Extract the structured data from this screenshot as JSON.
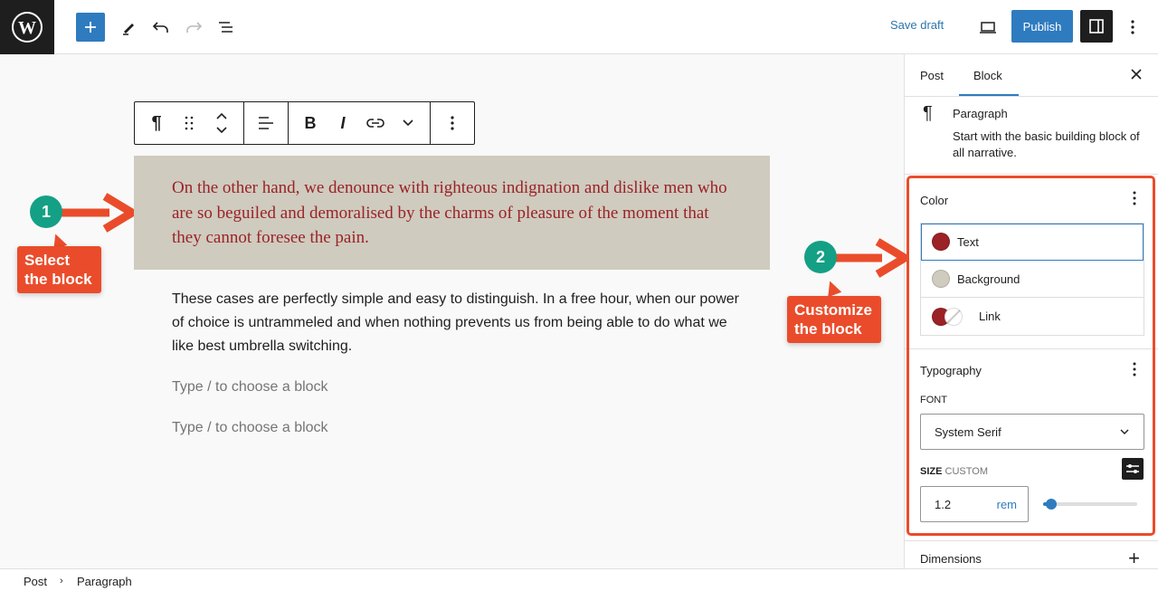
{
  "topbar": {
    "logo": "wordpress-logo",
    "inserter_label": "+",
    "save_draft": "Save draft",
    "publish": "Publish"
  },
  "block_toolbar": {
    "paragraph_glyph": "¶",
    "bold": "B",
    "italic": "I"
  },
  "editor": {
    "selected_paragraph": "On the other hand, we denounce with righteous indignation and dislike men who are so beguiled and demoralised by the charms of pleasure of the moment that they cannot foresee the pain.",
    "paragraph": "These cases are perfectly simple and easy to distinguish. In a free hour, when our power of choice is untrammeled and when nothing prevents us from being able to do what we like best umbrella switching.",
    "placeholders": [
      "Type / to choose a block",
      "Type / to choose a block"
    ],
    "selected_block_bg": "#cfcbbf",
    "selected_block_text_color": "#9b2226"
  },
  "sidebar": {
    "tabs": [
      {
        "label": "Post"
      },
      {
        "label": "Block"
      }
    ],
    "active_tab": "Block",
    "block_card": {
      "icon": "¶",
      "title": "Paragraph",
      "description": "Start with the basic building block of all narrative."
    },
    "color_panel": {
      "title": "Color",
      "items": [
        {
          "label": "Text",
          "color": "#9b2226"
        },
        {
          "label": "Background",
          "color": "#cfcbbf"
        },
        {
          "label": "Link",
          "color": "#9b2226"
        }
      ]
    },
    "typography_panel": {
      "title": "Typography",
      "font_label": "FONT",
      "font_value": "System Serif",
      "size_label": "SIZE",
      "size_sublabel": "CUSTOM",
      "size_value": "1.2",
      "size_unit": "rem",
      "slider_fraction": 0.09
    },
    "dimensions_panel": {
      "title": "Dimensions",
      "add_glyph": "+"
    }
  },
  "footer": {
    "breadcrumbs": [
      "Post",
      "Paragraph"
    ]
  },
  "annotations": [
    {
      "number": "1",
      "text": "Select the block"
    },
    {
      "number": "2",
      "text": "Customize the block"
    }
  ],
  "colors": {
    "accent": "#2f7bbf",
    "annotation_red": "#ea4c2b",
    "annotation_teal": "#14a085"
  }
}
